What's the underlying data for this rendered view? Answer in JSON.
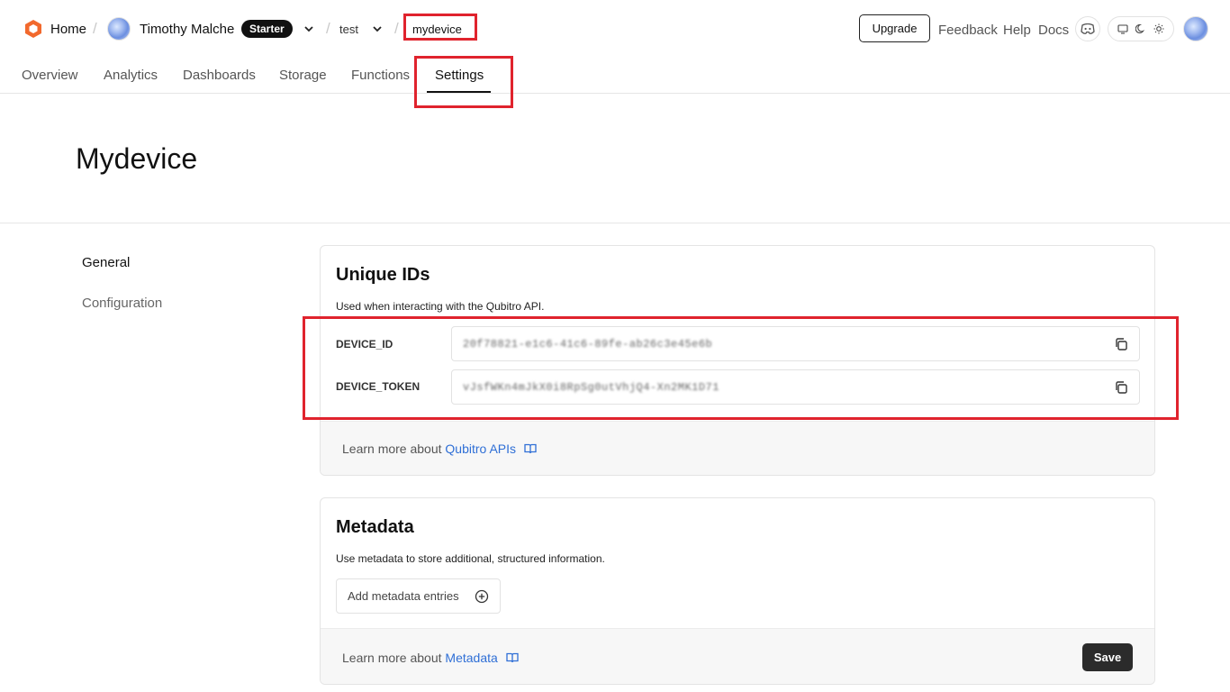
{
  "breadcrumb": {
    "home": "Home",
    "user": "Timothy Malche",
    "plan_badge": "Starter",
    "project": "test",
    "device": "mydevice"
  },
  "header_actions": {
    "upgrade": "Upgrade",
    "feedback": "Feedback",
    "help": "Help",
    "docs": "Docs"
  },
  "tabs": [
    {
      "label": "Overview"
    },
    {
      "label": "Analytics"
    },
    {
      "label": "Dashboards"
    },
    {
      "label": "Storage"
    },
    {
      "label": "Functions"
    },
    {
      "label": "Settings",
      "active": true
    }
  ],
  "page": {
    "title": "Mydevice"
  },
  "sidebar": {
    "items": [
      {
        "label": "General",
        "active": true
      },
      {
        "label": "Configuration"
      }
    ]
  },
  "unique_ids": {
    "title": "Unique IDs",
    "description": "Used when interacting with the Qubitro API.",
    "device_id_label": "DEVICE_ID",
    "device_id_value": "20f78821-e1c6-41c6-89fe-ab26c3e45e6b",
    "device_token_label": "DEVICE_TOKEN",
    "device_token_value": "vJsfWKn4mJkX0i8RpSg0utVhjQ4-Xn2MK1D71",
    "footer_prefix": "Learn more about",
    "footer_link": "Qubitro APIs"
  },
  "metadata": {
    "title": "Metadata",
    "description": "Use metadata to store additional, structured information.",
    "add_button": "Add metadata entries",
    "footer_prefix": "Learn more about",
    "footer_link": "Metadata",
    "save_button": "Save"
  },
  "colors": {
    "accent_logo": "#f2692d",
    "highlight_red": "#e0232d",
    "link_blue": "#2f6fd6"
  }
}
